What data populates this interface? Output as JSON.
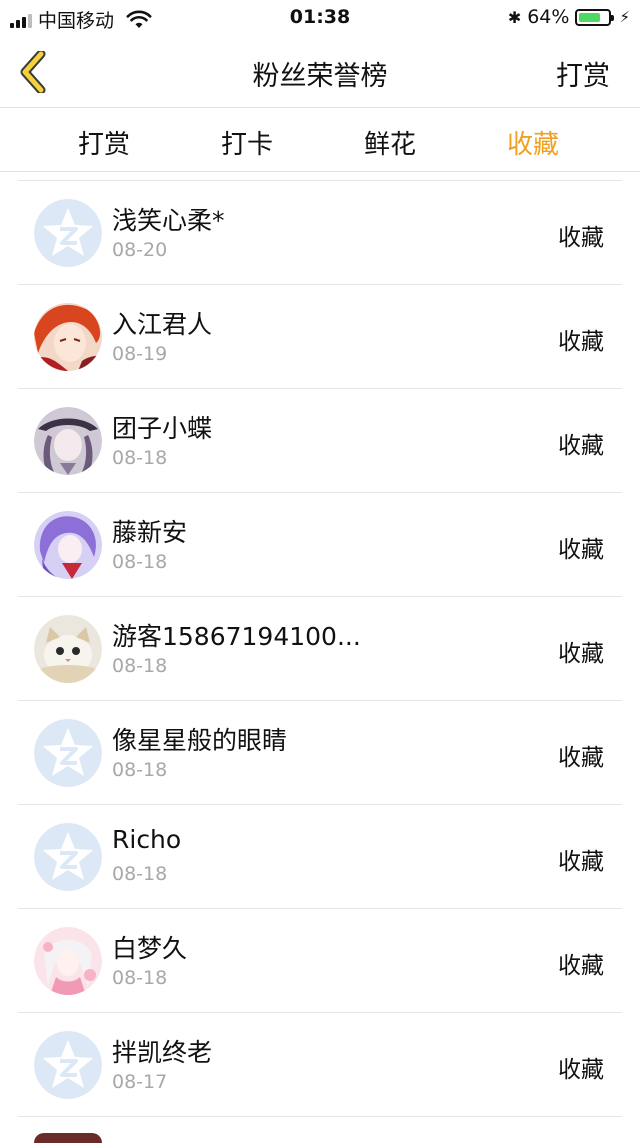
{
  "status_bar": {
    "carrier": "中国移动",
    "time": "01:38",
    "battery": "64%",
    "bluetooth_symbol": "✱",
    "charging_symbol": "⚡"
  },
  "nav": {
    "title": "粉丝荣誉榜",
    "action_label": "打赏"
  },
  "tabs": [
    {
      "label": "打赏",
      "active": false
    },
    {
      "label": "打卡",
      "active": false
    },
    {
      "label": "鲜花",
      "active": false
    },
    {
      "label": "收藏",
      "active": true
    }
  ],
  "colors": {
    "accent": "#f0a020",
    "back_arrow_stroke": "#3a3a3a",
    "back_arrow_fill": "#f4d23c",
    "divider": "#e6e6e6",
    "date_text": "#a8a8a8",
    "default_avatar_bg": "#dce8f5"
  },
  "list": [
    {
      "name": "浅笑心柔*",
      "date": "08-20",
      "action": "收藏",
      "avatar": "default-avatar-icon"
    },
    {
      "name": "入江君人",
      "date": "08-19",
      "action": "收藏",
      "avatar": "anime-avatar-red"
    },
    {
      "name": "团子小蝶",
      "date": "08-18",
      "action": "收藏",
      "avatar": "anime-avatar-purple-hat"
    },
    {
      "name": "藤新安",
      "date": "08-18",
      "action": "收藏",
      "avatar": "anime-avatar-violet"
    },
    {
      "name": "游客15867194100...",
      "date": "08-18",
      "action": "收藏",
      "avatar": "cat-avatar"
    },
    {
      "name": "像星星般的眼睛",
      "date": "08-18",
      "action": "收藏",
      "avatar": "default-avatar-icon"
    },
    {
      "name": "Richo",
      "date": "08-18",
      "action": "收藏",
      "avatar": "default-avatar-icon"
    },
    {
      "name": "白梦久",
      "date": "08-18",
      "action": "收藏",
      "avatar": "anime-avatar-pink"
    },
    {
      "name": "拌凯终老",
      "date": "08-17",
      "action": "收藏",
      "avatar": "default-avatar-icon"
    }
  ]
}
